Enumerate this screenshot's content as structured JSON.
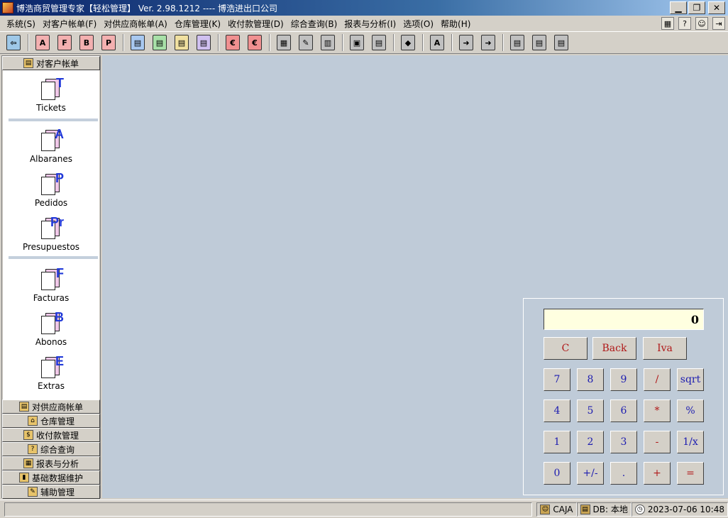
{
  "window": {
    "title": "博浩商贸管理专家【轻松管理】 Ver. 2.98.1212 ---- 博浩进出口公司",
    "minimize": "▁",
    "restore": "❐",
    "close": "✕"
  },
  "menu": {
    "items": [
      "系统(S)",
      "对客户帐单(F)",
      "对供应商帐单(A)",
      "仓库管理(K)",
      "收付款管理(D)",
      "综合查询(B)",
      "报表与分析(I)",
      "选项(O)",
      "帮助(H)"
    ]
  },
  "toolbar": {
    "buttons": [
      {
        "glyph": "⇦",
        "color": "#9ec8e8"
      },
      {
        "glyph": "A",
        "color": "#f3b0b0"
      },
      {
        "glyph": "F",
        "color": "#f3b0b0"
      },
      {
        "glyph": "B",
        "color": "#f3b0b0"
      },
      {
        "glyph": "P",
        "color": "#f3b0b0"
      },
      {
        "glyph": "▤",
        "color": "#a8c8f0"
      },
      {
        "glyph": "▤",
        "color": "#a8e0a8"
      },
      {
        "glyph": "▤",
        "color": "#f0e0a0"
      },
      {
        "glyph": "▤",
        "color": "#d0c0f0"
      },
      {
        "glyph": "€",
        "color": "#f09090"
      },
      {
        "glyph": "€",
        "color": "#f09090"
      },
      {
        "glyph": "▦",
        "color": "#c0c0c0"
      },
      {
        "glyph": "✎",
        "color": "#c0c0c0"
      },
      {
        "glyph": "▥",
        "color": "#c0c0c0"
      },
      {
        "glyph": "▣",
        "color": "#c0c0c0"
      },
      {
        "glyph": "▤",
        "color": "#c0c0c0"
      },
      {
        "glyph": "◆",
        "color": "#c0c0c0"
      },
      {
        "glyph": "A",
        "color": "#c0c0c0"
      },
      {
        "glyph": "➜",
        "color": "#c0c0c0"
      },
      {
        "glyph": "➜",
        "color": "#c0c0c0"
      },
      {
        "glyph": "▤",
        "color": "#c0c0c0"
      },
      {
        "glyph": "▤",
        "color": "#c0c0c0"
      },
      {
        "glyph": "▤",
        "color": "#c0c0c0"
      }
    ]
  },
  "sidebar": {
    "header": "对客户帐单",
    "entries": [
      {
        "label": "Tickets",
        "letter": "T"
      },
      {
        "label": "Albaranes",
        "letter": "A"
      },
      {
        "label": "Pedidos",
        "letter": "P"
      },
      {
        "label": "Presupuestos",
        "letter": "Pr"
      },
      {
        "label": "Facturas",
        "letter": "F"
      },
      {
        "label": "Abonos",
        "letter": "B"
      },
      {
        "label": "Extras",
        "letter": "E"
      }
    ],
    "nav": [
      {
        "label": "对供应商帐单",
        "glyph": "▤"
      },
      {
        "label": "仓库管理",
        "glyph": "⌂"
      },
      {
        "label": "收付款管理",
        "glyph": "$"
      },
      {
        "label": "综合查询",
        "glyph": "?"
      },
      {
        "label": "报表与分析",
        "glyph": "▦"
      },
      {
        "label": "基础数据维护",
        "glyph": "▮"
      },
      {
        "label": "辅助管理",
        "glyph": "✎"
      }
    ]
  },
  "calculator": {
    "display": "0",
    "top_row": [
      "C",
      "Back",
      "Iva"
    ],
    "rows": [
      [
        "7",
        "8",
        "9",
        "/",
        "sqrt"
      ],
      [
        "4",
        "5",
        "6",
        "*",
        "%"
      ],
      [
        "1",
        "2",
        "3",
        "-",
        "1/x"
      ],
      [
        "0",
        "+/-",
        ".",
        "+",
        "="
      ]
    ]
  },
  "status": {
    "user": "CAJA",
    "db": "DB: 本地",
    "datetime": "2023-07-06 10:48"
  }
}
